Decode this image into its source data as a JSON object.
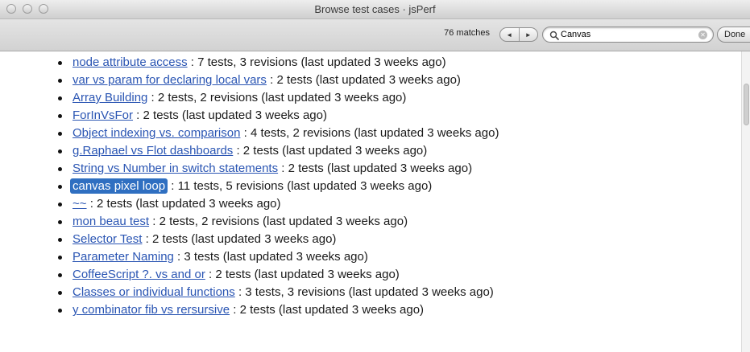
{
  "window": {
    "title": "Browse test cases · jsPerf"
  },
  "findbar": {
    "match_count": "76 matches",
    "prev_icon": "◄",
    "next_icon": "►",
    "search_value": "Canvas",
    "done_label": "Done"
  },
  "results": [
    {
      "link": "node attribute access",
      "meta": " : 7 tests, 3 revisions (last updated 3 weeks ago)"
    },
    {
      "link": "var vs param for declaring local vars",
      "meta": " : 2 tests (last updated 3 weeks ago)"
    },
    {
      "link": "Array Building",
      "meta": " : 2 tests, 2 revisions (last updated 3 weeks ago)"
    },
    {
      "link": "ForInVsFor",
      "meta": " : 2 tests (last updated 3 weeks ago)"
    },
    {
      "link": "Object indexing vs. comparison",
      "meta": " : 4 tests, 2 revisions (last updated 3 weeks ago)"
    },
    {
      "link": "g.Raphael vs Flot dashboards",
      "meta": " : 2 tests (last updated 3 weeks ago)"
    },
    {
      "link": "String vs Number in switch statements",
      "meta": " : 2 tests (last updated 3 weeks ago)"
    },
    {
      "link": "canvas pixel loop",
      "meta": " : 11 tests, 5 revisions (last updated 3 weeks ago)"
    },
    {
      "link": "~~",
      "meta": " : 2 tests (last updated 3 weeks ago)"
    },
    {
      "link": "mon beau test",
      "meta": " : 2 tests, 2 revisions (last updated 3 weeks ago)"
    },
    {
      "link": "Selector Test",
      "meta": " : 2 tests (last updated 3 weeks ago)"
    },
    {
      "link": "Parameter Naming",
      "meta": " : 3 tests (last updated 3 weeks ago)"
    },
    {
      "link": "CoffeeScript ?. vs and or",
      "meta": " : 2 tests (last updated 3 weeks ago)"
    },
    {
      "link": "Classes or individual functions",
      "meta": " : 3 tests, 3 revisions (last updated 3 weeks ago)"
    },
    {
      "link": "y combinator fib vs rersursive",
      "meta": " : 2 tests (last updated 3 weeks ago)"
    }
  ],
  "colors": {
    "link": "#2a55b3",
    "highlight": "#2f6fc1"
  },
  "icons": {
    "search": "magnifying-glass-icon",
    "clear": "clear-search-icon"
  }
}
